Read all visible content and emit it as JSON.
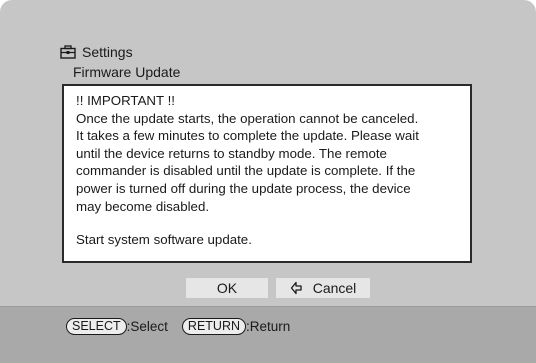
{
  "header": {
    "title": "Settings",
    "icon": "toolbox-icon"
  },
  "subtitle": "Firmware Update",
  "message": {
    "lines": [
      "!! IMPORTANT !!",
      "Once the update starts, the operation cannot be canceled.",
      "It takes a few minutes to complete the update.  Please wait",
      "until the device returns to standby mode.  The remote",
      "commander is disabled until the update is complete.  If the",
      "power is turned off during the update process, the device",
      "may become disabled."
    ],
    "prompt": "Start system software update."
  },
  "buttons": {
    "ok_label": "OK",
    "cancel_label": "Cancel"
  },
  "footer": {
    "select_key": "SELECT",
    "select_label": ":Select",
    "return_key": "RETURN",
    "return_label": ":Return"
  },
  "colors": {
    "screen_bg": "#c6c6c6",
    "footer_bg": "#a9a9a9",
    "dialog_bg": "#ffffff",
    "button_bg": "#e6e6e6"
  }
}
